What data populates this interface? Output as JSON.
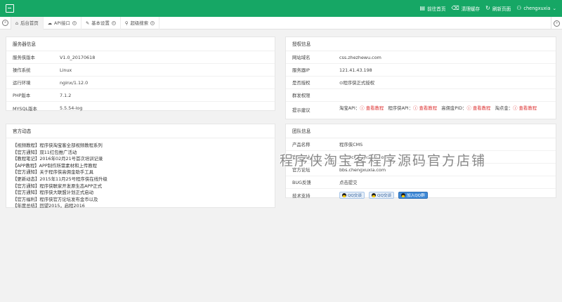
{
  "topbar": {
    "actions": [
      {
        "label": "前往首页",
        "icon": "home-icon",
        "glyph": "▤"
      },
      {
        "label": "清理缓存",
        "icon": "trash-icon",
        "glyph": "⌫"
      },
      {
        "label": "刷新页面",
        "icon": "refresh-icon",
        "glyph": "↻"
      }
    ],
    "user": {
      "name": "chengxuxia",
      "icon": "user-icon",
      "glyph": "⚇",
      "caret": "⌄"
    }
  },
  "tabs": [
    {
      "label": "后台首页",
      "glyph": "⌂",
      "icon": "home-icon"
    },
    {
      "label": "API接口",
      "glyph": "☁",
      "icon": "cloud-icon"
    },
    {
      "label": "基本设置",
      "glyph": "✎",
      "icon": "edit-icon"
    },
    {
      "label": "超级搜索",
      "glyph": "⚲",
      "icon": "search-icon"
    }
  ],
  "server": {
    "title": "服务器信息",
    "rows": [
      {
        "k": "服务侠版本",
        "v": "V1.0_20170618"
      },
      {
        "k": "操作系统",
        "v": "Linux"
      },
      {
        "k": "运行环境",
        "v": "nginx/1.12.0"
      },
      {
        "k": "PHP版本",
        "v": "7.1.2"
      },
      {
        "k": "MYSQL版本",
        "v": "5.5.54-log"
      }
    ]
  },
  "auth": {
    "title": "授权信息",
    "site": {
      "k": "网站域名",
      "v": "css.zhezhewu.com"
    },
    "ip": {
      "k": "服务器IP",
      "v": "121.41.43.198"
    },
    "authorized": {
      "k": "是否授权",
      "v": "程序侠正式授权"
    },
    "group": {
      "k": "群发权限",
      "v": ""
    },
    "tip": {
      "k": "提示建议",
      "items": [
        {
          "pre": "淘宝API：",
          "link": "查看教程"
        },
        {
          "pre": "程序侠API：",
          "link": "查看教程"
        },
        {
          "pre": "高佣金PID：",
          "link": "查看教程"
        },
        {
          "pre": "淘点金：",
          "link": "查看教程"
        }
      ]
    }
  },
  "news": {
    "title": "官方动态",
    "items": [
      "【视频教程】程序侠淘宝客全部视频教程系列",
      "【官方通知】双11红包推广活动",
      "【教程笔记】2016年02月21号首次培训记录",
      "【APP教程】APP制作所需素材和上传教程",
      "【官方通知】关于程序侠高佣金助手工具",
      "【更新动态】2015年11月25号程序侠在线升级",
      "【官方通知】程序侠联家开发原生态APP正式",
      "【官方通知】程序侠大联盟计划正式启动",
      "【官方福利】程序侠官方论坛发布金币以及",
      "【年度总结】回望2015，启程2016"
    ]
  },
  "team": {
    "title": "团队信息",
    "product": {
      "k": "产品名称",
      "v": "程序侠CMS"
    },
    "site": {
      "k": "官方网站",
      "v": "www.chengxuxia.com"
    },
    "forum": {
      "k": "官方论坛",
      "v": "bbs.chengxuxia.com"
    },
    "bug": {
      "k": "BUG反馈",
      "v": "点击提交"
    },
    "support": {
      "k": "技术支持",
      "buttons": [
        "QQ交谈",
        "QQ交谈",
        "加入QQ群"
      ]
    }
  },
  "watermark": "程序侠淘宝客程序源码官方店铺",
  "colors": {
    "brand": "#16a765",
    "danger": "#dd3333"
  }
}
